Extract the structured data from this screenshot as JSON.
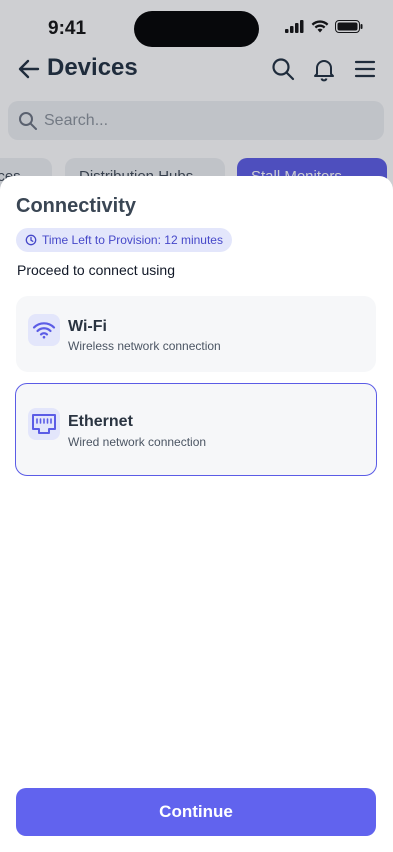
{
  "status": {
    "time": "9:41"
  },
  "header": {
    "title": "Devices"
  },
  "search": {
    "placeholder": "Search..."
  },
  "chips": [
    "ices",
    "Distribution Hubs",
    "Stall Monitors"
  ],
  "sheet": {
    "title": "Connectivity",
    "timer": "Time Left to Provision: 12 minutes",
    "prompt": "Proceed to connect using",
    "options": [
      {
        "title": "Wi-Fi",
        "subtitle": "Wireless network connection",
        "icon": "wifi-icon",
        "selected": false
      },
      {
        "title": "Ethernet",
        "subtitle": "Wired network connection",
        "icon": "ethernet-icon",
        "selected": true
      }
    ],
    "continue_label": "Continue"
  },
  "colors": {
    "accent": "#6163ee",
    "badge_bg": "#e3e6fb",
    "card_bg": "#f6f7f9"
  }
}
